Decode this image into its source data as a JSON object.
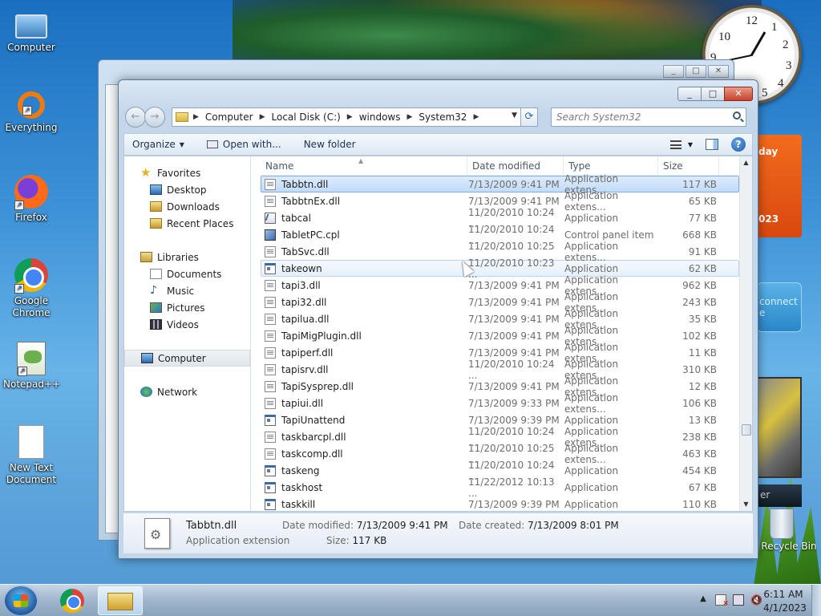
{
  "desktop": {
    "icons": [
      {
        "label": "Computer",
        "icon": "computer-icon"
      },
      {
        "label": "Everything",
        "icon": "everything-icon"
      },
      {
        "label": "Firefox",
        "icon": "firefox-icon"
      },
      {
        "label": "Google Chrome",
        "icon": "chrome-icon"
      },
      {
        "label": "Notepad++",
        "icon": "notepadpp-icon"
      },
      {
        "label": "New Text Document",
        "icon": "text-document-icon"
      }
    ],
    "recycle_bin": "Recycle Bin",
    "gadgets": {
      "clock_numbers": [
        "10",
        "12",
        "1",
        "2",
        "3",
        "4",
        "5",
        "9"
      ],
      "calendar_text": "day",
      "calendar_year": "023",
      "network_text": "connect",
      "network_text2": "e",
      "media_text": "er"
    }
  },
  "window": {
    "caption_buttons": [
      "_",
      "□",
      "✕"
    ],
    "nav": {
      "back": "←",
      "forward": "→"
    },
    "breadcrumb": [
      "Computer",
      "Local Disk (C:)",
      "windows",
      "System32"
    ],
    "search_placeholder": "Search System32",
    "toolbar": {
      "organize": "Organize",
      "open_with": "Open with...",
      "new_folder": "New folder"
    },
    "navpane": {
      "favorites": "Favorites",
      "favorites_items": [
        "Desktop",
        "Downloads",
        "Recent Places"
      ],
      "libraries": "Libraries",
      "libraries_items": [
        "Documents",
        "Music",
        "Pictures",
        "Videos"
      ],
      "computer": "Computer",
      "network": "Network"
    },
    "columns": {
      "name": "Name",
      "date": "Date modified",
      "type": "Type",
      "size": "Size"
    },
    "files": [
      {
        "name": "Tabbtn.dll",
        "date": "7/13/2009 9:41 PM",
        "type": "Application extens...",
        "size": "117 KB",
        "kind": "dll"
      },
      {
        "name": "TabbtnEx.dll",
        "date": "7/13/2009 9:41 PM",
        "type": "Application extens...",
        "size": "65 KB",
        "kind": "dll"
      },
      {
        "name": "tabcal",
        "date": "11/20/2010 10:24 ...",
        "type": "Application",
        "size": "77 KB",
        "kind": "cal"
      },
      {
        "name": "TabletPC.cpl",
        "date": "11/20/2010 10:24 ...",
        "type": "Control panel item",
        "size": "668 KB",
        "kind": "cpl"
      },
      {
        "name": "TabSvc.dll",
        "date": "11/20/2010 10:25 ...",
        "type": "Application extens...",
        "size": "91 KB",
        "kind": "dll"
      },
      {
        "name": "takeown",
        "date": "11/20/2010 10:23 ...",
        "type": "Application",
        "size": "62 KB",
        "kind": "exe"
      },
      {
        "name": "tapi3.dll",
        "date": "7/13/2009 9:41 PM",
        "type": "Application extens...",
        "size": "962 KB",
        "kind": "dll"
      },
      {
        "name": "tapi32.dll",
        "date": "7/13/2009 9:41 PM",
        "type": "Application extens...",
        "size": "243 KB",
        "kind": "dll"
      },
      {
        "name": "tapilua.dll",
        "date": "7/13/2009 9:41 PM",
        "type": "Application extens...",
        "size": "35 KB",
        "kind": "dll"
      },
      {
        "name": "TapiMigPlugin.dll",
        "date": "7/13/2009 9:41 PM",
        "type": "Application extens...",
        "size": "102 KB",
        "kind": "dll"
      },
      {
        "name": "tapiperf.dll",
        "date": "7/13/2009 9:41 PM",
        "type": "Application extens...",
        "size": "11 KB",
        "kind": "dll"
      },
      {
        "name": "tapisrv.dll",
        "date": "11/20/2010 10:24 ...",
        "type": "Application extens...",
        "size": "310 KB",
        "kind": "dll"
      },
      {
        "name": "TapiSysprep.dll",
        "date": "7/13/2009 9:41 PM",
        "type": "Application extens...",
        "size": "12 KB",
        "kind": "dll"
      },
      {
        "name": "tapiui.dll",
        "date": "7/13/2009 9:33 PM",
        "type": "Application extens...",
        "size": "106 KB",
        "kind": "dll"
      },
      {
        "name": "TapiUnattend",
        "date": "7/13/2009 9:39 PM",
        "type": "Application",
        "size": "13 KB",
        "kind": "exe"
      },
      {
        "name": "taskbarcpl.dll",
        "date": "11/20/2010 10:24 ...",
        "type": "Application extens...",
        "size": "238 KB",
        "kind": "dll"
      },
      {
        "name": "taskcomp.dll",
        "date": "11/20/2010 10:25 ...",
        "type": "Application extens...",
        "size": "463 KB",
        "kind": "dll"
      },
      {
        "name": "taskeng",
        "date": "11/20/2010 10:24 ...",
        "type": "Application",
        "size": "454 KB",
        "kind": "exe"
      },
      {
        "name": "taskhost",
        "date": "11/22/2012 10:13 ...",
        "type": "Application",
        "size": "67 KB",
        "kind": "exe"
      },
      {
        "name": "taskkill",
        "date": "7/13/2009 9:39 PM",
        "type": "Application",
        "size": "110 KB",
        "kind": "exe"
      }
    ],
    "selected_index": 0,
    "hover_index": 5,
    "details": {
      "name": "Tabbtn.dll",
      "type": "Application extension",
      "date_modified_label": "Date modified:",
      "date_modified": "7/13/2009 9:41 PM",
      "size_label": "Size:",
      "size": "117 KB",
      "date_created_label": "Date created:",
      "date_created": "7/13/2009 8:01 PM"
    }
  },
  "taskbar": {
    "time": "6:11 AM",
    "date": "4/1/2023",
    "tray_arrow": "▲"
  }
}
